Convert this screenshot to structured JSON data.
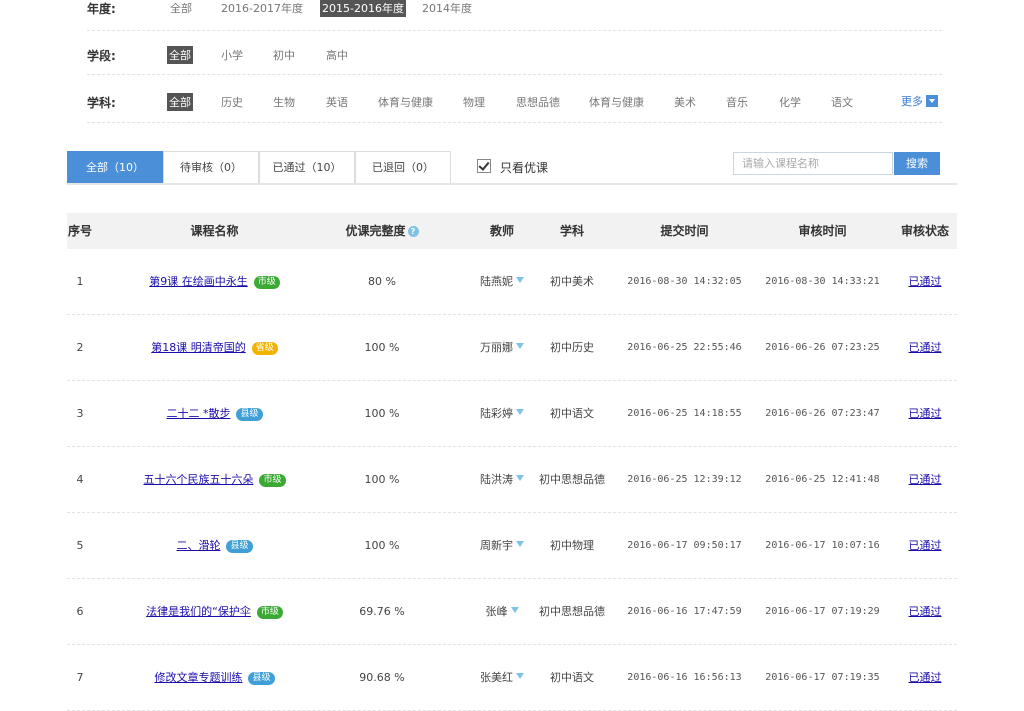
{
  "filters": {
    "year": {
      "label": "年度:",
      "options": [
        "全部",
        "2016-2017年度",
        "2015-2016年度",
        "2014年度"
      ],
      "selected": 2
    },
    "stage": {
      "label": "学段:",
      "options": [
        "全部",
        "小学",
        "初中",
        "高中"
      ],
      "selected": 0
    },
    "subject": {
      "label": "学科:",
      "options": [
        "全部",
        "历史",
        "生物",
        "英语",
        "体育与健康",
        "物理",
        "思想品德",
        "体育与健康",
        "美术",
        "音乐",
        "化学",
        "语文"
      ],
      "selected": 0,
      "more_label": "更多"
    }
  },
  "tabs": [
    {
      "label": "全部（10）"
    },
    {
      "label": "待审核（0）"
    },
    {
      "label": "已通过（10）"
    },
    {
      "label": "已退回（0）"
    }
  ],
  "only_excellent": {
    "label": "只看优课",
    "checked": true
  },
  "search": {
    "placeholder": "请输入课程名称",
    "button": "搜索"
  },
  "table": {
    "headers": {
      "index": "序号",
      "course": "课程名称",
      "completeness": "优课完整度",
      "teacher": "教师",
      "subject": "学科",
      "submitted": "提交时间",
      "reviewed": "审核时间",
      "status": "审核状态"
    },
    "badge_colors": {
      "市级": "#3aaa35",
      "省级": "#f0b400",
      "县级": "#3f9fd6"
    },
    "rows": [
      {
        "index": "1",
        "course": "第9课 在绘画中永生",
        "level": "市级",
        "completeness": "80 %",
        "teacher": "陆燕妮",
        "subject": "初中美术",
        "submitted": "2016-08-30 14:32:05",
        "reviewed": "2016-08-30 14:33:21",
        "status": "已通过"
      },
      {
        "index": "2",
        "course": "第18课 明清帝国的",
        "level": "省级",
        "completeness": "100 %",
        "teacher": "万丽娜",
        "subject": "初中历史",
        "submitted": "2016-06-25 22:55:46",
        "reviewed": "2016-06-26 07:23:25",
        "status": "已通过"
      },
      {
        "index": "3",
        "course": "二十二 *散步",
        "level": "县级",
        "completeness": "100 %",
        "teacher": "陆彩婷",
        "subject": "初中语文",
        "submitted": "2016-06-25 14:18:55",
        "reviewed": "2016-06-26 07:23:47",
        "status": "已通过"
      },
      {
        "index": "4",
        "course": "五十六个民族五十六朵",
        "level": "市级",
        "completeness": "100 %",
        "teacher": "陆洪涛",
        "subject": "初中思想品德",
        "submitted": "2016-06-25 12:39:12",
        "reviewed": "2016-06-25 12:41:48",
        "status": "已通过"
      },
      {
        "index": "5",
        "course": "二、滑轮",
        "level": "县级",
        "completeness": "100 %",
        "teacher": "周新宇",
        "subject": "初中物理",
        "submitted": "2016-06-17 09:50:17",
        "reviewed": "2016-06-17 10:07:16",
        "status": "已通过"
      },
      {
        "index": "6",
        "course": "法律是我们的“保护伞",
        "level": "市级",
        "completeness": "69.76 %",
        "teacher": "张峰",
        "subject": "初中思想品德",
        "submitted": "2016-06-16 17:47:59",
        "reviewed": "2016-06-17 07:19:29",
        "status": "已通过"
      },
      {
        "index": "7",
        "course": "修改文章专题训练",
        "level": "县级",
        "completeness": "90.68 %",
        "teacher": "张美红",
        "subject": "初中语文",
        "submitted": "2016-06-16 16:56:13",
        "reviewed": "2016-06-17 07:19:35",
        "status": "已通过"
      }
    ]
  }
}
